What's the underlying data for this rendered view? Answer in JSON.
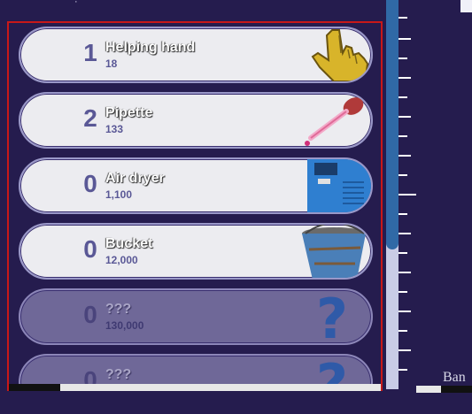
{
  "store": {
    "items": [
      {
        "count": "1",
        "name": "Helping hand",
        "price": "18",
        "icon": "pointing-hand-icon",
        "locked": false
      },
      {
        "count": "2",
        "name": "Pipette",
        "price": "133",
        "icon": "pipette-icon",
        "locked": false
      },
      {
        "count": "0",
        "name": "Air dryer",
        "price": "1,100",
        "icon": "air-dryer-icon",
        "locked": false
      },
      {
        "count": "0",
        "name": "Bucket",
        "price": "12,000",
        "icon": "bucket-icon",
        "locked": false
      },
      {
        "count": "0",
        "name": "???",
        "price": "130,000",
        "icon": "question-mark-icon",
        "locked": true
      },
      {
        "count": "0",
        "name": "???",
        "price": "",
        "icon": "question-mark-icon",
        "locked": true
      }
    ]
  },
  "side": {
    "ban_text": "Ban"
  },
  "colors": {
    "accent": "#c81818",
    "scroll": "#3069a6",
    "background": "#251c4e"
  }
}
